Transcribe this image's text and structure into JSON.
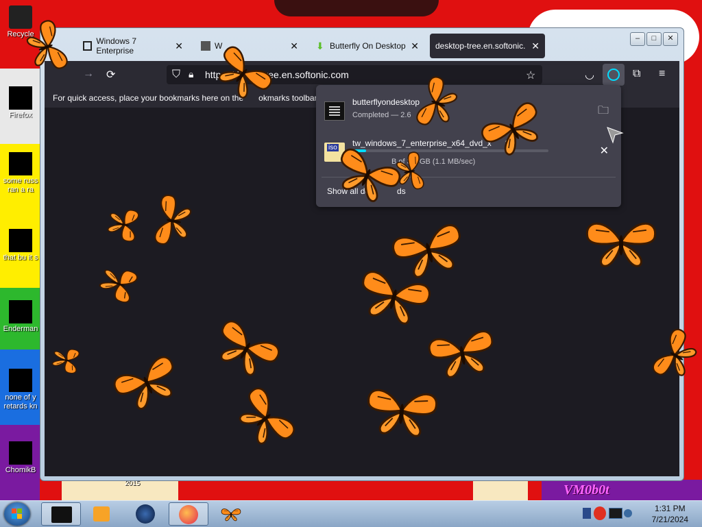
{
  "desktop": {
    "icons": [
      {
        "label": "Recycle"
      },
      {
        "label": "Firefox"
      },
      {
        "label": "some russ ran a ra"
      },
      {
        "label": "that bu it s"
      },
      {
        "label": "Enderman"
      },
      {
        "label": "none of y retards kn"
      },
      {
        "label": "ChomikB"
      }
    ],
    "wallpaper_text": "2015",
    "vm_logo": "VM0b0t"
  },
  "browser": {
    "tabs": [
      {
        "label": "Windows 7 Enterprise",
        "close": "✕"
      },
      {
        "label": "W",
        "close": "✕"
      },
      {
        "label": "Butterfly On Desktop",
        "close": "✕"
      },
      {
        "label": "desktop-tree.en.softonic.",
        "close": "✕"
      }
    ],
    "url": "https://de",
    "url_tail": "ree.en.softonic.com",
    "bookmarks_text": "For quick access, place your bookmarks here on the",
    "bookmarks_text_tail": "okmarks toolbar.",
    "bookmarks_link": "M"
  },
  "downloads": {
    "items": [
      {
        "name": "butterflyondesktop",
        "status": "Completed — 2.6"
      },
      {
        "name": "tw_windows_7_enterprise_x64_dvd_x",
        "name_tail": "8",
        "status": "B of 3.0 GB (1.1 MB/sec)",
        "progress_percent": 7,
        "icon_text": "iso"
      }
    ],
    "show_all": "Show all do",
    "show_all_tail": "ds"
  },
  "taskbar": {
    "time": "1:31 PM",
    "date": "7/21/2024"
  },
  "colors": {
    "toolbar": "#2b2a33",
    "content": "#1c1b22",
    "accent": "#00ddff",
    "butterfly": "#ff8c1a"
  }
}
